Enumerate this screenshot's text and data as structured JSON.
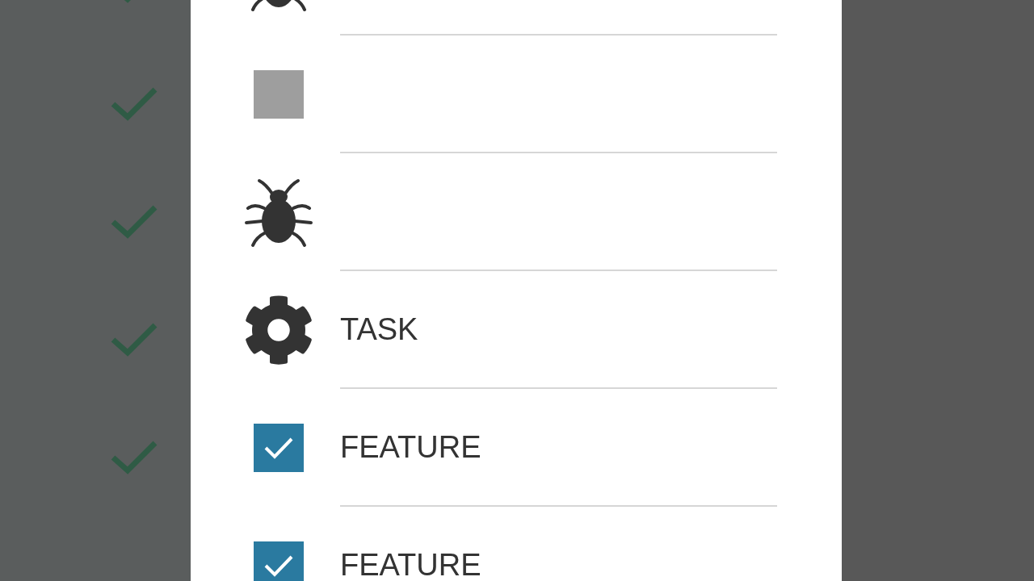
{
  "background_rows": [
    {
      "checked": true
    },
    {
      "checked": true
    },
    {
      "checked": true
    },
    {
      "checked": true
    },
    {
      "checked": true
    }
  ],
  "dialog": {
    "rows": [
      {
        "kind": "bug"
      },
      {
        "kind": "checkbox",
        "checked": false
      },
      {
        "kind": "bug"
      },
      {
        "kind": "gear",
        "label": "TASK"
      },
      {
        "kind": "checkbox",
        "checked": true,
        "label": "FEATURE"
      },
      {
        "kind": "checkbox",
        "checked": true,
        "label": "FEATURE"
      }
    ]
  }
}
